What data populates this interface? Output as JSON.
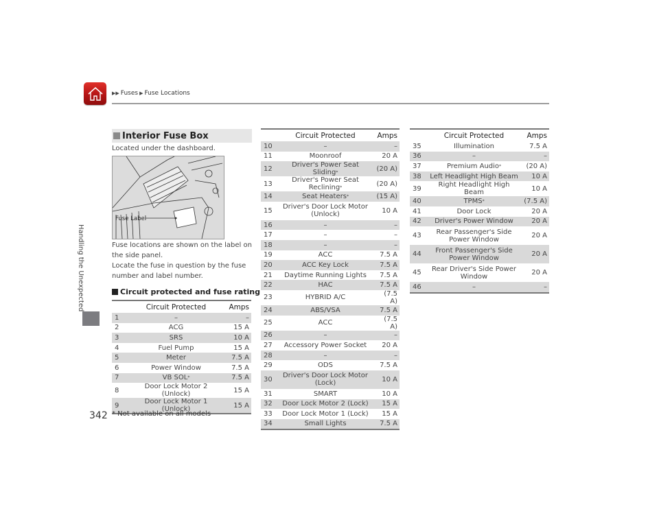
{
  "header": {
    "home_icon": "home-icon",
    "breadcrumb": [
      "Fuses",
      "Fuse Locations"
    ],
    "accent_color": "#c41e1e"
  },
  "sidebar": {
    "chapter": "Handling the Unexpected"
  },
  "section": {
    "title": "Interior Fuse Box",
    "intro": "Located under the dashboard.",
    "illustration_label": "Fuse Label",
    "desc_lines": [
      "Fuse locations are shown on the label on the side panel.",
      "Locate the fuse in question by the fuse number and label number."
    ],
    "subtitle": "Circuit protected and fuse rating"
  },
  "table_headers": {
    "circuit": "Circuit Protected",
    "amps": "Amps"
  },
  "tables": [
    {
      "rows": [
        {
          "num": "1",
          "circuit": "–",
          "amps": "–"
        },
        {
          "num": "2",
          "circuit": "ACG",
          "amps": "15 A"
        },
        {
          "num": "3",
          "circuit": "SRS",
          "amps": "10 A"
        },
        {
          "num": "4",
          "circuit": "Fuel Pump",
          "amps": "15 A"
        },
        {
          "num": "5",
          "circuit": "Meter",
          "amps": "7.5 A"
        },
        {
          "num": "6",
          "circuit": "Power Window",
          "amps": "7.5 A"
        },
        {
          "num": "7",
          "circuit": "VB SOL*",
          "amps": "7.5 A"
        },
        {
          "num": "8",
          "circuit": "Door Lock Motor 2 (Unlock)",
          "amps": "15 A"
        },
        {
          "num": "9",
          "circuit": "Door Lock Motor 1 (Unlock)",
          "amps": "15 A"
        }
      ]
    },
    {
      "rows": [
        {
          "num": "10",
          "circuit": "–",
          "amps": "–"
        },
        {
          "num": "11",
          "circuit": "Moonroof",
          "amps": "20 A"
        },
        {
          "num": "12",
          "circuit": "Driver's Power Seat Sliding*",
          "amps": "(20 A)"
        },
        {
          "num": "13",
          "circuit": "Driver's Power Seat Reclining*",
          "amps": "(20 A)"
        },
        {
          "num": "14",
          "circuit": "Seat Heaters*",
          "amps": "(15 A)"
        },
        {
          "num": "15",
          "circuit": "Driver's Door Lock Motor (Unlock)",
          "amps": "10 A"
        },
        {
          "num": "16",
          "circuit": "–",
          "amps": "–"
        },
        {
          "num": "17",
          "circuit": "–",
          "amps": "–"
        },
        {
          "num": "18",
          "circuit": "–",
          "amps": "–"
        },
        {
          "num": "19",
          "circuit": "ACC",
          "amps": "7.5 A"
        },
        {
          "num": "20",
          "circuit": "ACC Key Lock",
          "amps": "7.5 A"
        },
        {
          "num": "21",
          "circuit": "Daytime Running Lights",
          "amps": "7.5 A"
        },
        {
          "num": "22",
          "circuit": "HAC",
          "amps": "7.5 A"
        },
        {
          "num": "23",
          "circuit": "HYBRID A/C",
          "amps": "(7.5 A)"
        },
        {
          "num": "24",
          "circuit": "ABS/VSA",
          "amps": "7.5 A"
        },
        {
          "num": "25",
          "circuit": "ACC",
          "amps": "(7.5 A)"
        },
        {
          "num": "26",
          "circuit": "–",
          "amps": "–"
        },
        {
          "num": "27",
          "circuit": "Accessory Power Socket",
          "amps": "20 A"
        },
        {
          "num": "28",
          "circuit": "–",
          "amps": "–"
        },
        {
          "num": "29",
          "circuit": "ODS",
          "amps": "7.5 A"
        },
        {
          "num": "30",
          "circuit": "Driver's Door Lock Motor (Lock)",
          "amps": "10 A"
        },
        {
          "num": "31",
          "circuit": "SMART",
          "amps": "10 A"
        },
        {
          "num": "32",
          "circuit": "Door Lock Motor 2 (Lock)",
          "amps": "15 A"
        },
        {
          "num": "33",
          "circuit": "Door Lock Motor 1 (Lock)",
          "amps": "15 A"
        },
        {
          "num": "34",
          "circuit": "Small Lights",
          "amps": "7.5 A"
        }
      ]
    },
    {
      "rows": [
        {
          "num": "35",
          "circuit": "Illumination",
          "amps": "7.5 A"
        },
        {
          "num": "36",
          "circuit": "–",
          "amps": "–"
        },
        {
          "num": "37",
          "circuit": "Premium Audio*",
          "amps": "(20 A)"
        },
        {
          "num": "38",
          "circuit": "Left Headlight High Beam",
          "amps": "10 A"
        },
        {
          "num": "39",
          "circuit": "Right Headlight High Beam",
          "amps": "10 A"
        },
        {
          "num": "40",
          "circuit": "TPMS*",
          "amps": "(7.5 A)"
        },
        {
          "num": "41",
          "circuit": "Door Lock",
          "amps": "20 A"
        },
        {
          "num": "42",
          "circuit": "Driver's Power Window",
          "amps": "20 A"
        },
        {
          "num": "43",
          "circuit": "Rear Passenger's Side Power Window",
          "amps": "20 A"
        },
        {
          "num": "44",
          "circuit": "Front Passenger's Side Power Window",
          "amps": "20 A"
        },
        {
          "num": "45",
          "circuit": "Rear Driver's Side Power Window",
          "amps": "20 A"
        },
        {
          "num": "46",
          "circuit": "–",
          "amps": "–"
        }
      ]
    }
  ],
  "footer": {
    "page_number": "342",
    "footnote": "* Not available on all models"
  }
}
